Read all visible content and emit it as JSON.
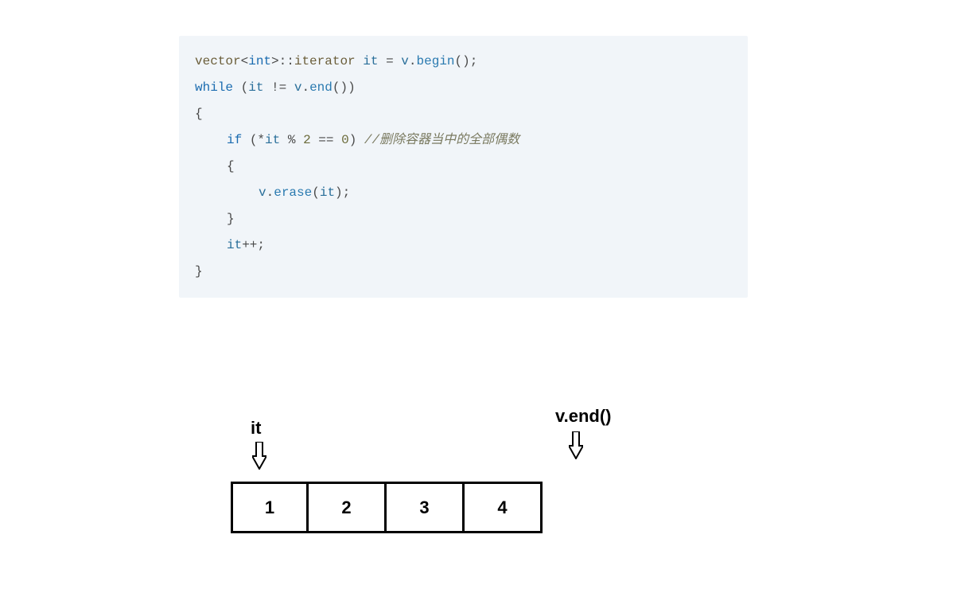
{
  "code": {
    "kw_while": "while",
    "kw_if": "if",
    "type_vector": "vector",
    "type_int": "int",
    "type_iterator": "iterator",
    "id_it": "it",
    "id_v": "v",
    "func_begin": "begin",
    "func_end": "end",
    "func_erase": "erase",
    "num_2": "2",
    "num_0": "0",
    "op_ne": "!=",
    "op_eq": "==",
    "op_mod": "%",
    "op_star": "*",
    "op_incr": "++",
    "op_assign": "=",
    "angle_l": "<",
    "angle_r": ">",
    "dcolon": "::",
    "dot": ".",
    "paren_l": "(",
    "paren_r": ")",
    "brace_l": "{",
    "brace_r": "}",
    "semi": ";",
    "comment_prefix": "//",
    "comment_text": "删除容器当中的全部偶数"
  },
  "diagram": {
    "label_it": "it",
    "label_end": "v.end()",
    "cells": [
      "1",
      "2",
      "3",
      "4"
    ]
  }
}
